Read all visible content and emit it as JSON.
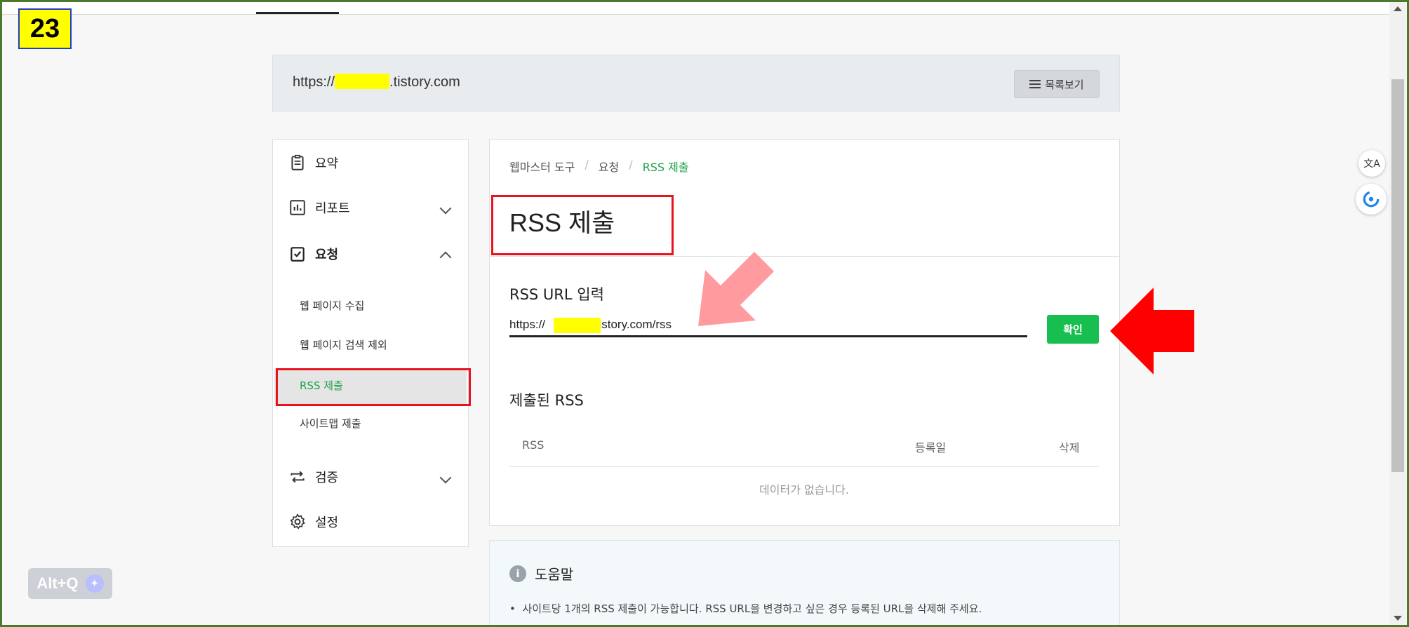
{
  "step_badge": "23",
  "url_bar": {
    "prefix": "https://",
    "suffix": ".tistory.com",
    "list_button": "목록보기"
  },
  "sidebar": {
    "summary": "요약",
    "report": "리포트",
    "request": "요청",
    "sub": [
      "웹 페이지 수집",
      "웹 페이지 검색 제외",
      "RSS 제출",
      "사이트맵 제출"
    ],
    "verify": "검증",
    "settings": "설정"
  },
  "breadcrumb": [
    "웹마스터 도구",
    "요청",
    "RSS 제출"
  ],
  "page_title": "RSS 제출",
  "rss_url_label": "RSS URL 입력",
  "rss_input": {
    "prefix": "https://",
    "suffix": ".tistory.com/rss"
  },
  "confirm_button": "확인",
  "submitted_label": "제출된 RSS",
  "table": {
    "columns": [
      "RSS",
      "등록일",
      "삭제"
    ],
    "empty": "데이터가 없습니다."
  },
  "help": {
    "title": "도움말",
    "note": "사이트당 1개의 RSS 제출이 가능합니다. RSS URL을 변경하고 싶은 경우 등록된 URL을 삭제해 주세요."
  },
  "alt_badge": "Alt+Q",
  "translate_icon": "文A",
  "colors": {
    "accent_green": "#16bf4f",
    "annotation_red": "#e8141d",
    "highlight_yellow": "#ffff00"
  }
}
